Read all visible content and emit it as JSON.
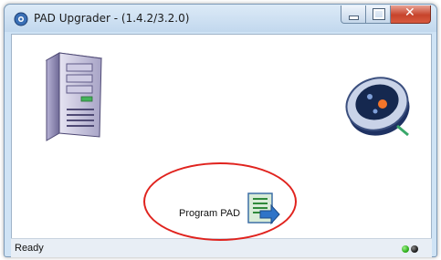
{
  "window": {
    "title": "PAD Upgrader - (1.4.2/3.2.0)"
  },
  "main": {
    "program_label": "Program PAD"
  },
  "status": {
    "text": "Ready",
    "indicator_colors": [
      "#2fb11d",
      "#222222"
    ]
  },
  "icons": {
    "app": "app-icon",
    "server": "server-icon",
    "aed": "aed-device-icon",
    "program": "program-arrow-icon"
  },
  "colors": {
    "annotation": "#e0231e",
    "title_bar": "#cfe3f5",
    "close_button": "#c7442c"
  }
}
